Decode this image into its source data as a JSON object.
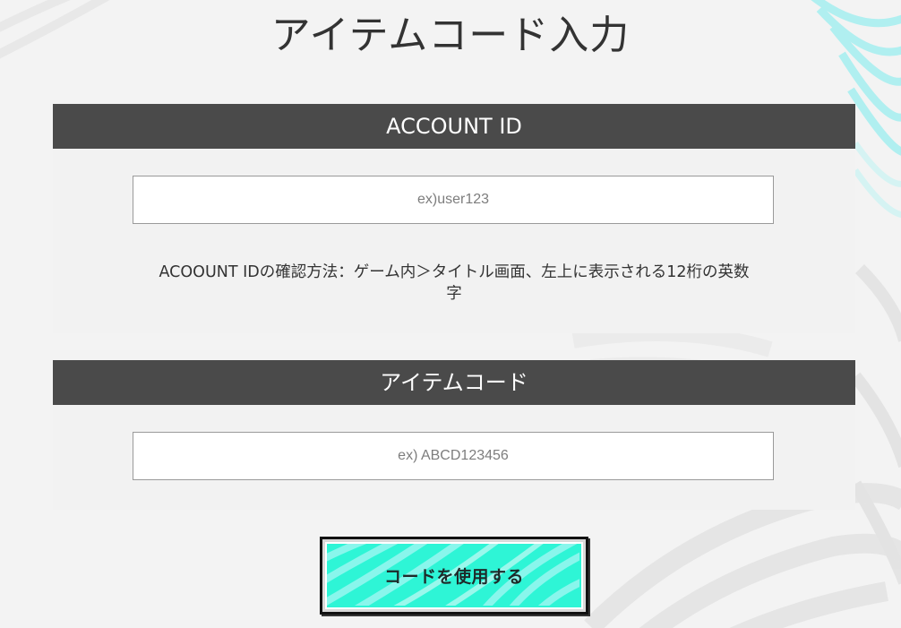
{
  "page": {
    "title": "アイテムコード入力"
  },
  "account_panel": {
    "header": "ACCOUNT ID",
    "input_value": "",
    "input_placeholder": "ex)user123",
    "help_text_line1": "ACOOUNT IDの確認方法：ゲーム内＞タイトル画面、左上に表示される12桁の英数",
    "help_text_line2": "字"
  },
  "item_panel": {
    "header": "アイテムコード",
    "input_value": "",
    "input_placeholder": "ex) ABCD123456"
  },
  "submit": {
    "label": "コードを使用する"
  },
  "colors": {
    "page_background": "#f3f3f3",
    "panel_background": "#f2f2f2",
    "panel_header": "#4a4a4a",
    "button_accent": "#2ef5d6",
    "background_accent": "#7ee8ea"
  }
}
